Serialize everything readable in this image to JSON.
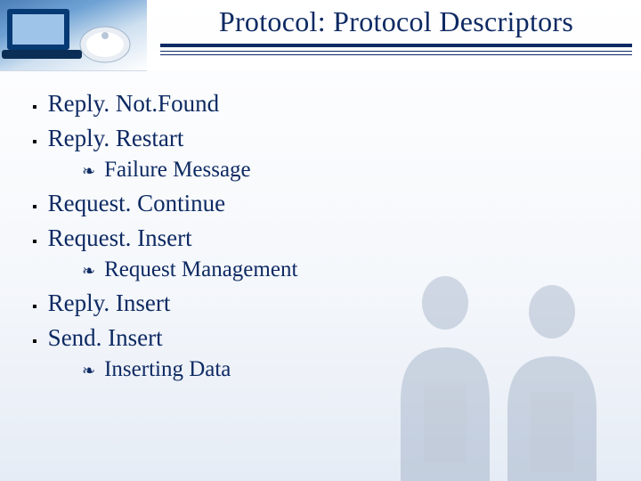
{
  "title": "Protocol: Protocol Descriptors",
  "bullets": [
    {
      "level": 1,
      "text": "Reply. Not.Found"
    },
    {
      "level": 1,
      "text": "Reply. Restart"
    },
    {
      "level": 2,
      "text": "Failure Message"
    },
    {
      "level": 1,
      "text": "Request. Continue"
    },
    {
      "level": 1,
      "text": "Request. Insert"
    },
    {
      "level": 2,
      "text": "Request Management"
    },
    {
      "level": 1,
      "text": "Reply. Insert"
    },
    {
      "level": 1,
      "text": "Send. Insert"
    },
    {
      "level": 2,
      "text": "Inserting Data"
    }
  ],
  "markers": {
    "lvl1": "▪",
    "lvl2": "❧"
  },
  "colors": {
    "accent": "#0e2a63"
  }
}
